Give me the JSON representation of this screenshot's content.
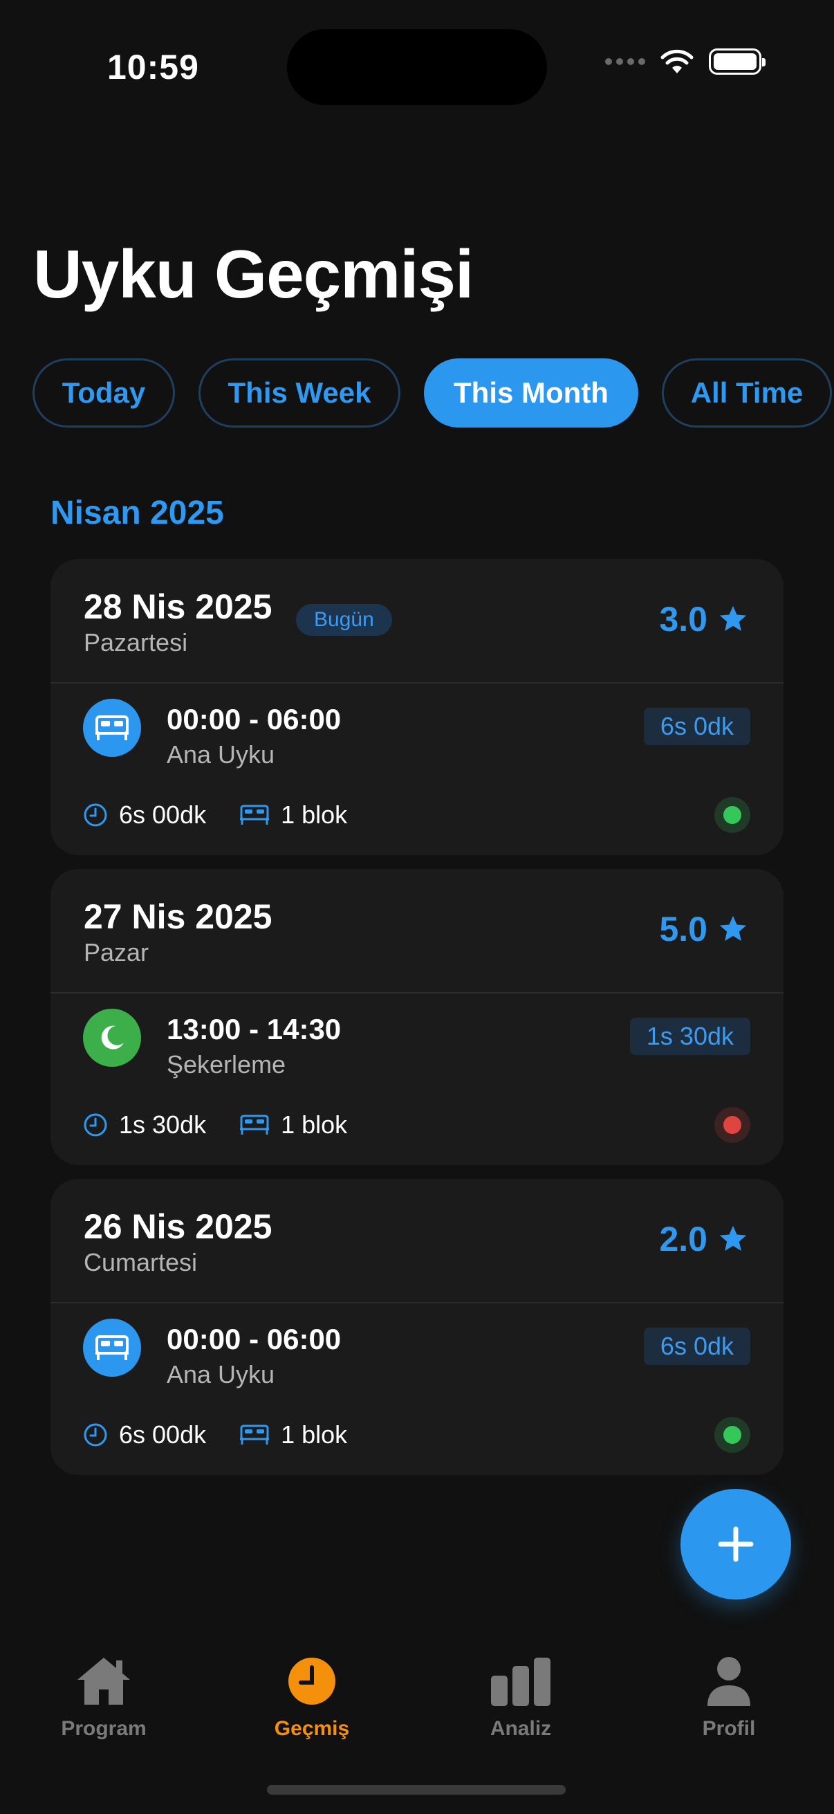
{
  "status_bar": {
    "time": "10:59"
  },
  "page": {
    "title": "Uyku Geçmişi"
  },
  "filters": [
    {
      "label": "Today",
      "active": false
    },
    {
      "label": "This Week",
      "active": false
    },
    {
      "label": "This Month",
      "active": true
    },
    {
      "label": "All Time",
      "active": false
    }
  ],
  "month_header": "Nisan 2025",
  "days": [
    {
      "date": "28 Nis 2025",
      "weekday": "Pazartesi",
      "badge": "Bugün",
      "rating": "3.0",
      "entry": {
        "time_range": "00:00 - 06:00",
        "type": "Ana Uyku",
        "icon": "bed-icon",
        "duration": "6s 0dk"
      },
      "total": "6s 00dk",
      "blocks": "1 blok",
      "status_color": "#34c759"
    },
    {
      "date": "27 Nis 2025",
      "weekday": "Pazar",
      "badge": "",
      "rating": "5.0",
      "entry": {
        "time_range": "13:00 - 14:30",
        "type": "Şekerleme",
        "icon": "moon-icon",
        "duration": "1s 30dk"
      },
      "total": "1s 30dk",
      "blocks": "1 blok",
      "status_color": "#e0443e"
    },
    {
      "date": "26 Nis 2025",
      "weekday": "Cumartesi",
      "badge": "",
      "rating": "2.0",
      "entry": {
        "time_range": "00:00 - 06:00",
        "type": "Ana Uyku",
        "icon": "bed-icon",
        "duration": "6s 0dk"
      },
      "total": "6s 00dk",
      "blocks": "1 blok",
      "status_color": "#34c759"
    }
  ],
  "tabs": [
    {
      "label": "Program",
      "icon": "house-icon",
      "active": false
    },
    {
      "label": "Geçmiş",
      "icon": "clock-icon",
      "active": true
    },
    {
      "label": "Analiz",
      "icon": "bar-chart-icon",
      "active": false
    },
    {
      "label": "Profil",
      "icon": "person-icon",
      "active": false
    }
  ],
  "colors": {
    "accent": "#2b97ef",
    "active_tab": "#f4900c",
    "background": "#111111",
    "card": "#1b1b1b"
  }
}
